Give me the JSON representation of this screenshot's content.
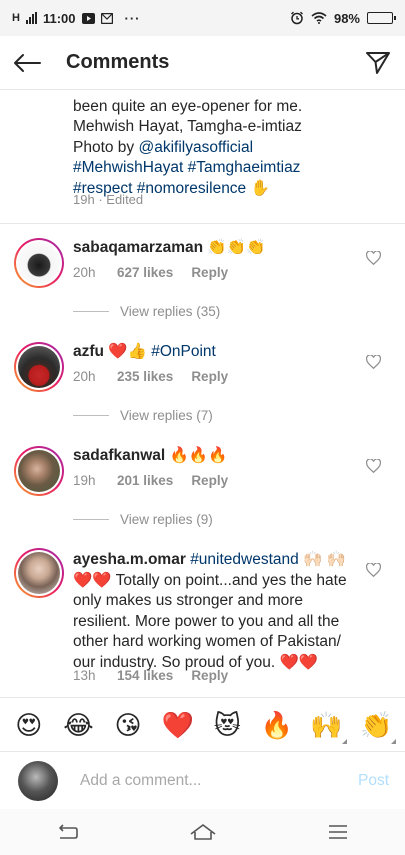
{
  "status_bar": {
    "network": "H",
    "time": "11:00",
    "battery_text": "98%",
    "battery_level": 0.98
  },
  "header": {
    "title": "Comments"
  },
  "caption": {
    "line1": "been quite an eye-opener for me.",
    "line2": "Mehwish Hayat, Tamgha-e-imtiaz",
    "photo_by": "Photo by ",
    "photo_handle": "@akifilyasofficial",
    "hashtags1": "#MehwishHayat #Tamghaeimtiaz",
    "hashtags2": "#respect #nomoresilence ✋",
    "time": "19h",
    "edited": "Edited"
  },
  "comments": [
    {
      "username": "sabaqamarzaman",
      "text": "👏👏👏",
      "time": "20h",
      "likes": "627 likes",
      "reply_label": "Reply",
      "view_replies": "View replies (35)"
    },
    {
      "username": "azfu",
      "text": "❤️👍",
      "hashtag": "#OnPoint",
      "time": "20h",
      "likes": "235 likes",
      "reply_label": "Reply",
      "view_replies": "View replies (7)"
    },
    {
      "username": "sadafkanwal",
      "text": "🔥🔥🔥",
      "time": "19h",
      "likes": "201 likes",
      "reply_label": "Reply",
      "view_replies": "View replies (9)"
    },
    {
      "username": "ayesha.m.omar",
      "hashtag": "#unitedwestand",
      "text": "🙌🏻 🙌🏻❤️❤️ Totally on point...and yes the hate only makes us stronger and more resilient. More power to you and all the other hard working women of Pakistan/ our industry. So proud of you. ❤️❤️",
      "time": "13h",
      "likes": "154 likes",
      "reply_label": "Reply"
    }
  ],
  "emoji_bar": [
    "😍",
    "😂",
    "😘",
    "❤️",
    "😻",
    "🔥",
    "🙌",
    "👏"
  ],
  "input": {
    "placeholder": "Add a comment...",
    "post_label": "Post"
  },
  "colors": {
    "link": "#00376b",
    "muted": "#8e8e8e",
    "post_disabled": "#b2dffc",
    "story_ring_start": "#f9a825",
    "story_ring_end": "#9c27b0"
  }
}
